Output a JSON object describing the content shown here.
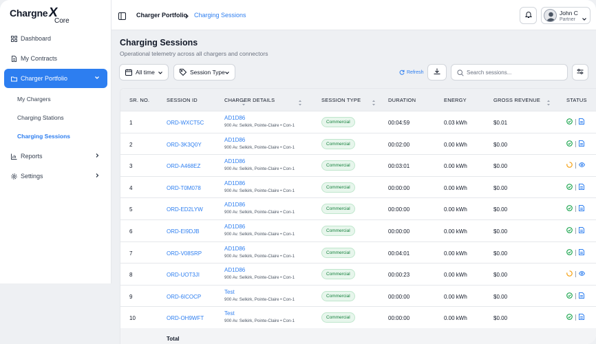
{
  "brand": {
    "name": "Chargne",
    "x": "X",
    "sub": "Core"
  },
  "sidebar": {
    "items": [
      {
        "label": "Dashboard",
        "icon": "grid-icon"
      },
      {
        "label": "My Contracts",
        "icon": "document-icon"
      },
      {
        "label": "Charger Portfolio",
        "icon": "folder-icon"
      },
      {
        "label": "Reports",
        "icon": "chart-icon"
      },
      {
        "label": "Settings",
        "icon": "gear-icon"
      }
    ],
    "sub": [
      "My Chargers",
      "Charging Stations",
      "Charging Sessions"
    ]
  },
  "topbar": {
    "crumb1": "Charger Portfolio",
    "crumb2": "Charging Sessions",
    "user_name": "John C",
    "user_role": "Partner"
  },
  "main": {
    "title": "Charging Sessions",
    "subtitle": "Operational telemetry across all chargers and connectors",
    "filter_time": "All time",
    "filter_type": "Session Type",
    "refresh": "Refresh",
    "search_placeholder": "Search sessions..."
  },
  "table": {
    "headers": [
      "SR. NO.",
      "SESSION ID",
      "CHARGER DETAILS",
      "SESSION TYPE",
      "DURATION",
      "ENERGY",
      "GROSS REVENUE",
      "STATUS"
    ],
    "rows": [
      {
        "sr": "1",
        "id": "ORD-WXCT5C",
        "charger": "AD1D86",
        "addr": "900 Av. Selkirk, Pointe-Claire • Con-1",
        "type": "Commercial",
        "duration": "00:04:59",
        "energy": "0.03 kWh",
        "revenue": "$0.01",
        "status": "done"
      },
      {
        "sr": "2",
        "id": "ORD-3K3Q0Y",
        "charger": "AD1D86",
        "addr": "900 Av. Selkirk, Pointe-Claire • Con-1",
        "type": "Commercial",
        "duration": "00:02:00",
        "energy": "0.00 kWh",
        "revenue": "$0.00",
        "status": "done"
      },
      {
        "sr": "3",
        "id": "ORD-A468EZ",
        "charger": "AD1D86",
        "addr": "900 Av. Selkirk, Pointe-Claire • Con-1",
        "type": "Commercial",
        "duration": "00:03:01",
        "energy": "0.00 kWh",
        "revenue": "$0.00",
        "status": "pending"
      },
      {
        "sr": "4",
        "id": "ORD-T0M078",
        "charger": "AD1D86",
        "addr": "900 Av. Selkirk, Pointe-Claire • Con-1",
        "type": "Commercial",
        "duration": "00:00:00",
        "energy": "0.00 kWh",
        "revenue": "$0.00",
        "status": "done"
      },
      {
        "sr": "5",
        "id": "ORD-ED2LYW",
        "charger": "AD1D86",
        "addr": "900 Av. Selkirk, Pointe-Claire • Con-1",
        "type": "Commercial",
        "duration": "00:00:00",
        "energy": "0.00 kWh",
        "revenue": "$0.00",
        "status": "done"
      },
      {
        "sr": "6",
        "id": "ORD-EI9DJB",
        "charger": "AD1D86",
        "addr": "900 Av. Selkirk, Pointe-Claire • Con-1",
        "type": "Commercial",
        "duration": "00:00:00",
        "energy": "0.00 kWh",
        "revenue": "$0.00",
        "status": "done"
      },
      {
        "sr": "7",
        "id": "ORD-V08SRP",
        "charger": "AD1D86",
        "addr": "900 Av. Selkirk, Pointe-Claire • Con-1",
        "type": "Commercial",
        "duration": "00:04:01",
        "energy": "0.00 kWh",
        "revenue": "$0.00",
        "status": "done"
      },
      {
        "sr": "8",
        "id": "ORD-UOT3JI",
        "charger": "AD1D86",
        "addr": "900 Av. Selkirk, Pointe-Claire • Con-1",
        "type": "Commercial",
        "duration": "00:00:23",
        "energy": "0.00 kWh",
        "revenue": "$0.00",
        "status": "pending"
      },
      {
        "sr": "9",
        "id": "ORD-6ICOCP",
        "charger": "Test",
        "addr": "900 Av. Selkirk, Pointe-Claire • Con-1",
        "type": "Commercial",
        "duration": "00:00:00",
        "energy": "0.00 kWh",
        "revenue": "$0.00",
        "status": "done"
      },
      {
        "sr": "10",
        "id": "ORD-OH9WFT",
        "charger": "Test",
        "addr": "900 Av. Selkirk, Pointe-Claire • Con-1",
        "type": "Commercial",
        "duration": "00:00:00",
        "energy": "0.00 kWh",
        "revenue": "$0.00",
        "status": "done"
      }
    ],
    "total_label": "Total"
  },
  "colors": {
    "accent": "#2d7ef0",
    "success": "#16a34a",
    "warning": "#f59e0b"
  }
}
